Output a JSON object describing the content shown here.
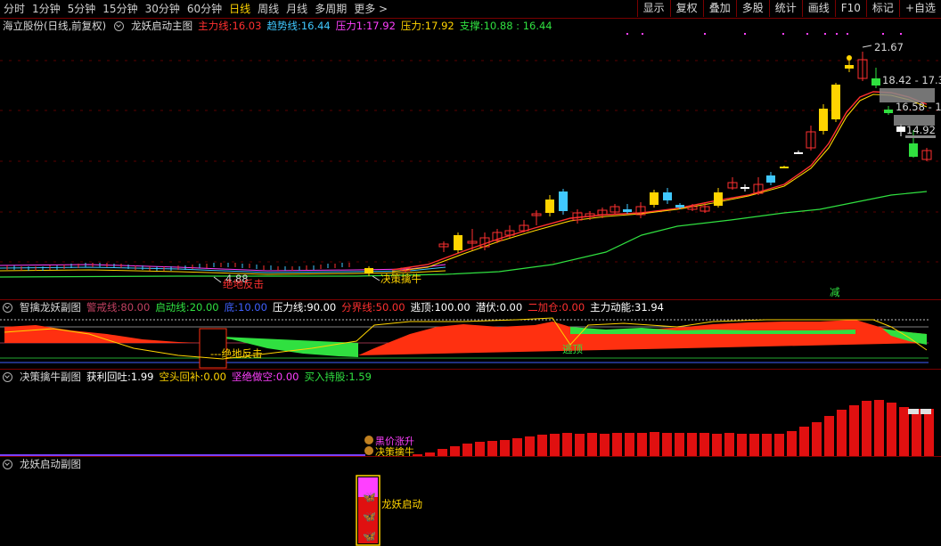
{
  "toolbar": {
    "periods": [
      "分时",
      "1分钟",
      "5分钟",
      "15分钟",
      "30分钟",
      "60分钟",
      "日线",
      "周线",
      "月线",
      "多周期",
      "更多 >"
    ],
    "active_period": "日线",
    "buttons": [
      "显示",
      "复权",
      "叠加",
      "多股",
      "统计",
      "画线",
      "F10",
      "标记",
      "+自选"
    ]
  },
  "main": {
    "stock": "海立股份(日线,前复权)",
    "indicator": "龙妖启动主图",
    "legend": [
      {
        "label": "主力线:",
        "value": "16.03",
        "color": "#ff3030"
      },
      {
        "label": "趋势线:",
        "value": "16.44",
        "color": "#40c8ff"
      },
      {
        "label": "压力1:",
        "value": "17.92",
        "color": "#ff40ff"
      },
      {
        "label": "压力:",
        "value": "17.92",
        "color": "#ffd400"
      },
      {
        "label": "支撑:",
        "value": "10.88 : 16.44",
        "color": "#30e040"
      }
    ],
    "price_labels": {
      "high": "21.67",
      "r1": "18.42 - 17.3",
      "r2": "16.58 - 1",
      "r3": "14.92",
      "low": "4.88"
    },
    "annotations": {
      "jue_di": "绝地反击",
      "jue_ce": "决策擒牛",
      "jian": "减"
    }
  },
  "sub1": {
    "title": "智擒龙妖副图",
    "legend": [
      {
        "label": "警戒线:",
        "value": "80.00",
        "color": "#c04060"
      },
      {
        "label": "启动线:",
        "value": "20.00",
        "color": "#30e040"
      },
      {
        "label": "底:",
        "value": "10.00",
        "color": "#4060ff"
      },
      {
        "label": "压力线:",
        "value": "90.00",
        "color": "#ffffff"
      },
      {
        "label": "分界线:",
        "value": "50.00",
        "color": "#ff3030"
      },
      {
        "label": "逃顶:",
        "value": "100.00",
        "color": "#ffffff"
      },
      {
        "label": "潜伏:",
        "value": "0.00",
        "color": "#ffffff"
      },
      {
        "label": "二加仓:",
        "value": "0.00",
        "color": "#ff3030"
      },
      {
        "label": "主力动能:",
        "value": "31.94",
        "color": "#ffffff"
      }
    ],
    "annotations": {
      "jue_di": "---绝地反击",
      "tao_ding": "逃顶"
    }
  },
  "sub2": {
    "title": "决策擒牛副图",
    "legend": [
      {
        "label": "获利回吐:",
        "value": "1.99",
        "color": "#ffffff"
      },
      {
        "label": "空头回补:",
        "value": "0.00",
        "color": "#ffd400"
      },
      {
        "label": "坚绝做空:",
        "value": "0.00",
        "color": "#ff40ff"
      },
      {
        "label": "买入持股:",
        "value": "1.59",
        "color": "#30e040"
      }
    ],
    "annotations": {
      "guo_li": "黑价涨升",
      "jue_ce": "决策擒牛"
    }
  },
  "sub3": {
    "title": "龙妖启动副图",
    "annotations": {
      "qi_dong": "龙妖启动"
    }
  },
  "colors": {
    "up": "#ff3030",
    "down": "#40c8ff",
    "yellow": "#ffd400",
    "green": "#30e040",
    "magenta": "#ff40ff"
  }
}
